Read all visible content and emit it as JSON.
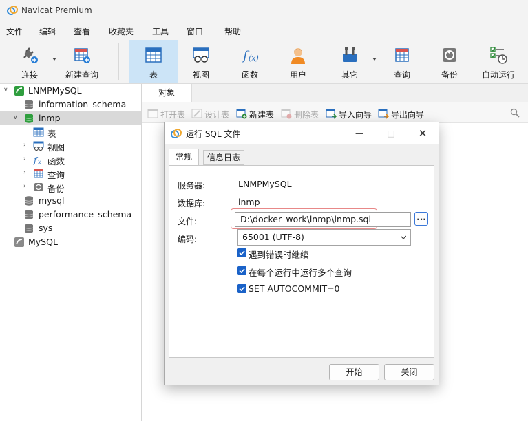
{
  "app": {
    "title": "Navicat Premium"
  },
  "menu": [
    "文件",
    "编辑",
    "查看",
    "收藏夹",
    "工具",
    "窗口",
    "帮助"
  ],
  "toolbar": {
    "connect": "连接",
    "new_query": "新建查询",
    "table": "表",
    "view": "视图",
    "function": "函数",
    "user": "用户",
    "other": "其它",
    "query": "查询",
    "backup": "备份",
    "autorun": "自动运行",
    "active": "表"
  },
  "tree": {
    "connection": "LNMPMySQL",
    "databases": [
      "information_schema",
      "lnmp",
      "mysql",
      "performance_schema",
      "sys"
    ],
    "selected_db": "lnmp",
    "lnmp_children": [
      "表",
      "视图",
      "函数",
      "查询",
      "备份"
    ],
    "other_connection": "MySQL"
  },
  "objects": {
    "tab": "对象",
    "toolbar": {
      "open_table": "打开表",
      "design_table": "设计表",
      "new_table": "新建表",
      "delete_table": "删除表",
      "import_wizard": "导入向导",
      "export_wizard": "导出向导"
    }
  },
  "dialog": {
    "title": "运行 SQL 文件",
    "tabs": [
      "常规",
      "信息日志"
    ],
    "server_label": "服务器:",
    "server_value": "LNMPMySQL",
    "database_label": "数据库:",
    "database_value": "lnmp",
    "file_label": "文件:",
    "file_value": "D:\\docker_work\\lnmp\\lnmp.sql",
    "browse": "...",
    "encoding_label": "编码:",
    "encoding_value": "65001 (UTF-8)",
    "options": [
      {
        "label": "遇到错误时继续",
        "checked": true
      },
      {
        "label": "在每个运行中运行多个查询",
        "checked": true
      },
      {
        "label": "SET AUTOCOMMIT=0",
        "checked": true
      }
    ],
    "start": "开始",
    "close": "关闭"
  },
  "colors": {
    "accent": "#1a62c8",
    "active_toolbar": "#cce4f7",
    "db_green": "#2f9e3e",
    "highlight": "#e88888"
  }
}
